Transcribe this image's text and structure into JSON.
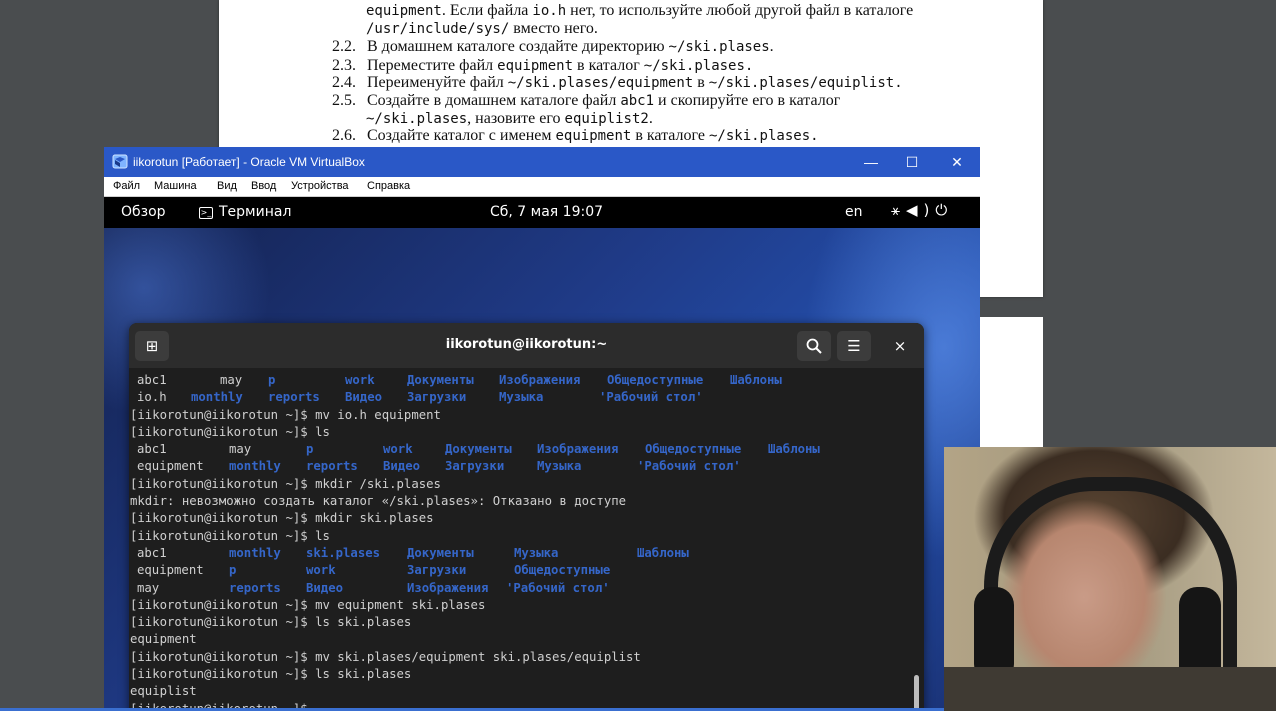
{
  "document": {
    "lines": [
      {
        "num": "",
        "html_parts": [
          "equipment",
          ". Если файла ",
          "io.h",
          " нет, то используйте любой другой файл в каталоге"
        ]
      },
      {
        "num": "",
        "html_parts": [
          "/usr/include/sys/",
          " вместо него.",
          "",
          ""
        ]
      },
      {
        "num": "2.2.",
        "html_parts": [
          "В домашнем каталоге создайте директорию ",
          "~/ski.plases",
          ".",
          ""
        ]
      },
      {
        "num": "2.3.",
        "html_parts": [
          "Переместите файл ",
          "equipment",
          " в каталог ",
          "~/ski.plases."
        ]
      },
      {
        "num": "2.4.",
        "html_parts": [
          "Переименуйте файл ",
          "~/ski.plases/equipment",
          " в ",
          "~/ski.plases/equiplist."
        ]
      },
      {
        "num": "2.5.",
        "html_parts": [
          "Создайте в домашнем каталоге файл ",
          "abc1",
          " и скопируйте его в каталог",
          ""
        ]
      },
      {
        "num": "",
        "html_parts": [
          "~/ski.plases",
          ", назовите его ",
          "equiplist2",
          "."
        ]
      },
      {
        "num": "2.6.",
        "html_parts": [
          "Создайте каталог с именем ",
          "equipment",
          " в каталоге ",
          "~/ski.plases."
        ]
      }
    ]
  },
  "virtualbox": {
    "title": "iikorotun [Работает] - Oracle VM VirtualBox",
    "menu": [
      "Файл",
      "Машина",
      "Вид",
      "Ввод",
      "Устройства",
      "Справка"
    ],
    "controls": {
      "minimize": "—",
      "maximize": "☐",
      "close": "✕"
    }
  },
  "gnome": {
    "overview": "Обзор",
    "app": "Терминал",
    "clock": "Сб, 7 мая  19:07",
    "lang": "en",
    "sys_icons": "⚹◀)⏻"
  },
  "terminal": {
    "title": "iikorotun@iikorotun:~",
    "new_tab_icon": "⊞",
    "search_icon": "🔍",
    "menu_icon": "☰",
    "close_icon": "×",
    "rows": [
      [
        [
          "abc1",
          1,
          7,
          false
        ],
        [
          "may",
          1,
          90,
          false
        ],
        [
          "p",
          1,
          138,
          true
        ],
        [
          "work",
          1,
          215,
          true
        ],
        [
          "Документы",
          1,
          277,
          true
        ],
        [
          "Изображения",
          1,
          369,
          true
        ],
        [
          "Общедоступные",
          1,
          477,
          true
        ],
        [
          "Шаблоны",
          1,
          600,
          true
        ]
      ],
      [
        [
          "io.h",
          1,
          7,
          false
        ],
        [
          "monthly",
          1,
          61,
          true
        ],
        [
          "reports",
          1,
          138,
          true
        ],
        [
          "Видео",
          1,
          215,
          true
        ],
        [
          "Загрузки",
          1,
          277,
          true
        ],
        [
          "Музыка",
          1,
          369,
          true
        ],
        [
          "'Рабочий стол'",
          1,
          469,
          true
        ]
      ],
      [
        [
          "[iikorotun@iikorotun ~]$ mv io.h equipment",
          0,
          0,
          false
        ]
      ],
      [
        [
          "[iikorotun@iikorotun ~]$ ls",
          0,
          0,
          false
        ]
      ],
      [
        [
          "abc1",
          1,
          7,
          false
        ],
        [
          "may",
          1,
          99,
          false
        ],
        [
          "p",
          1,
          176,
          true
        ],
        [
          "work",
          1,
          253,
          true
        ],
        [
          "Документы",
          1,
          315,
          true
        ],
        [
          "Изображения",
          1,
          407,
          true
        ],
        [
          "Общедоступные",
          1,
          515,
          true
        ],
        [
          "Шаблоны",
          1,
          638,
          true
        ]
      ],
      [
        [
          "equipment",
          1,
          7,
          false
        ],
        [
          "monthly",
          1,
          99,
          true
        ],
        [
          "reports",
          1,
          176,
          true
        ],
        [
          "Видео",
          1,
          253,
          true
        ],
        [
          "Загрузки",
          1,
          315,
          true
        ],
        [
          "Музыка",
          1,
          407,
          true
        ],
        [
          "'Рабочий стол'",
          1,
          507,
          true
        ]
      ],
      [
        [
          "[iikorotun@iikorotun ~]$ mkdir /ski.plases",
          0,
          0,
          false
        ]
      ],
      [
        [
          "mkdir: невозможно создать каталог «/ski.plases»: Отказано в доступе",
          0,
          0,
          false
        ]
      ],
      [
        [
          "[iikorotun@iikorotun ~]$ mkdir ski.plases",
          0,
          0,
          false
        ]
      ],
      [
        [
          "[iikorotun@iikorotun ~]$ ls",
          0,
          0,
          false
        ]
      ],
      [
        [
          "abc1",
          1,
          7,
          false
        ],
        [
          "monthly",
          1,
          99,
          true
        ],
        [
          "ski.plases",
          1,
          176,
          true
        ],
        [
          "Документы",
          1,
          277,
          true
        ],
        [
          "Музыка",
          1,
          384,
          true
        ],
        [
          "Шаблоны",
          1,
          507,
          true
        ]
      ],
      [
        [
          "equipment",
          1,
          7,
          false
        ],
        [
          "p",
          1,
          99,
          true
        ],
        [
          "work",
          1,
          176,
          true
        ],
        [
          "Загрузки",
          1,
          277,
          true
        ],
        [
          "Общедоступные",
          1,
          384,
          true
        ]
      ],
      [
        [
          "may",
          1,
          7,
          false
        ],
        [
          "reports",
          1,
          99,
          true
        ],
        [
          "Видео",
          1,
          176,
          true
        ],
        [
          "Изображения",
          1,
          277,
          true
        ],
        [
          "'Рабочий стол'",
          1,
          376,
          true
        ]
      ],
      [
        [
          "[iikorotun@iikorotun ~]$ mv equipment ski.plases",
          0,
          0,
          false
        ]
      ],
      [
        [
          "[iikorotun@iikorotun ~]$ ls ski.plases",
          0,
          0,
          false
        ]
      ],
      [
        [
          "equipment",
          0,
          0,
          false
        ]
      ],
      [
        [
          "[iikorotun@iikorotun ~]$ mv ski.plases/equipment ski.plases/equiplist",
          0,
          0,
          false
        ]
      ],
      [
        [
          "[iikorotun@iikorotun ~]$ ls ski.plases",
          0,
          0,
          false
        ]
      ],
      [
        [
          "equiplist",
          0,
          0,
          false
        ]
      ],
      [
        [
          "[iikorotun@iikorotun ~]$ ",
          0,
          0,
          false
        ]
      ]
    ]
  }
}
